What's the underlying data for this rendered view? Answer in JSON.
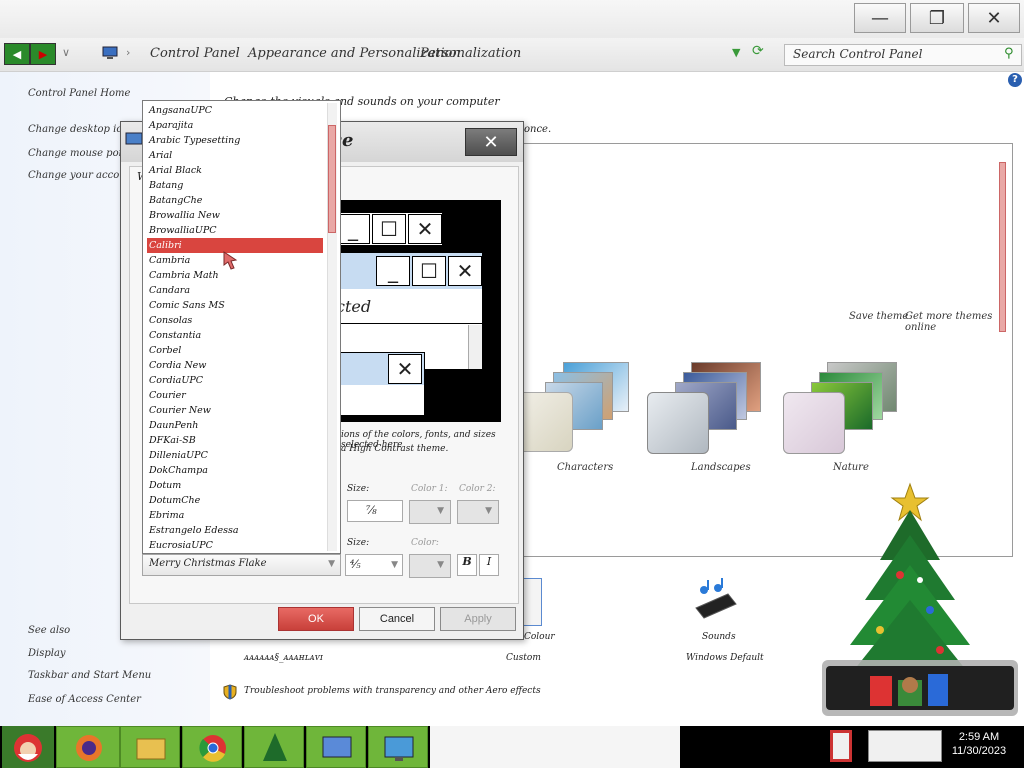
{
  "window": {
    "minimize_glyph": "—",
    "restore_glyph": "❐",
    "close_glyph": "✕"
  },
  "address_bar": {
    "breadcrumbs": [
      "Control Panel",
      "Appearance and Personalization",
      "Personalization"
    ],
    "search_placeholder": "Search Control Panel",
    "help_glyph": "?"
  },
  "left_pane": {
    "home_link": "Control Panel Home",
    "links": [
      "Change desktop icons",
      "Change mouse pointers",
      "Change your account picture"
    ],
    "see_also_heading": "See also",
    "see_also_links": [
      "Display",
      "Taskbar and Start Menu",
      "Ease of Access Center"
    ]
  },
  "main": {
    "heading": "Change the visuals and sounds on your computer",
    "subtext_fragment": "once.",
    "theme_actions": [
      "Save theme",
      "Get more themes online"
    ],
    "themes": [
      "Characters",
      "Landscapes",
      "Nature"
    ],
    "bottom_items": [
      {
        "name": "Colour",
        "value": "Custom"
      },
      {
        "name": "Sounds",
        "value": "Windows Default"
      }
    ],
    "screen_saver_text": "ᴀᴀᴀᴀᴀᴀ§_ᴀᴀᴀʜʟᴀᴠɪ",
    "troubleshoot_text": "Troubleshoot problems with transparency and other Aero effects"
  },
  "dialog": {
    "title_fragment": "ce",
    "tab_fragment": "W",
    "preview": {
      "selected_label": "cted"
    },
    "description_lines": [
      "ions of the colors, fonts, and sizes selected here",
      "a High Contrast theme."
    ],
    "size_label": "Size:",
    "size_value": "⅞",
    "color1_label": "Color 1:",
    "color2_label": "Color 2:",
    "font_size_label": "Size:",
    "font_size_value": "⅘",
    "font_color_label": "Color:",
    "bold_label": "B",
    "italic_label": "I",
    "font_value": "Merry Christmas Flake",
    "buttons": {
      "ok": "OK",
      "cancel": "Cancel",
      "apply": "Apply"
    }
  },
  "font_list": {
    "selected": "Calibri",
    "items": [
      "AngsanaUPC",
      "Aparajita",
      "Arabic Typesetting",
      "Arial",
      "Arial Black",
      "Batang",
      "BatangChe",
      "Browallia New",
      "BrowalliaUPC",
      "Calibri",
      "Cambria",
      "Cambria Math",
      "Candara",
      "Comic Sans MS",
      "Consolas",
      "Constantia",
      "Corbel",
      "Cordia New",
      "CordiaUPC",
      "Courier",
      "Courier New",
      "DaunPenh",
      "DFKai-SB",
      "DilleniaUPC",
      "DokChampa",
      "Dotum",
      "DotumChe",
      "Ebrima",
      "Estrangelo Edessa",
      "EucrosiaUPC"
    ]
  },
  "taskbar": {
    "clock_time": "2:59 AM",
    "clock_date": "11/30/2023"
  },
  "colors": {
    "selection": "#d9453f",
    "taskbar": "#000000",
    "task_item": "#6fb63a",
    "ok_button": "#d9514b"
  }
}
